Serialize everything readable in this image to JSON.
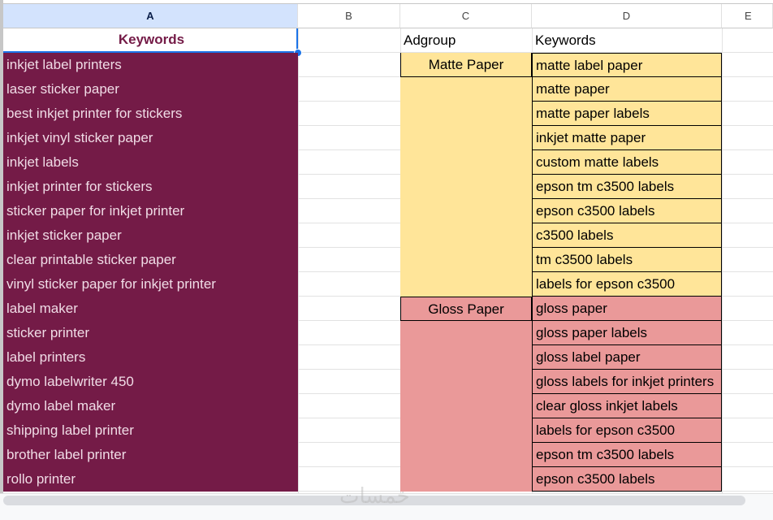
{
  "columns": [
    "A",
    "B",
    "C",
    "D",
    "E"
  ],
  "colA": {
    "header": "Keywords",
    "rows": [
      "inkjet label printers",
      "laser sticker paper",
      "best inkjet printer for stickers",
      "inkjet vinyl sticker paper",
      "inkjet labels",
      "inkjet printer for stickers",
      "sticker paper for inkjet printer",
      "inkjet sticker paper",
      "clear printable sticker paper",
      "vinyl sticker paper for inkjet printer",
      "label maker",
      "sticker printer",
      "label printers",
      "dymo labelwriter 450",
      "dymo label maker",
      "shipping label printer",
      "brother label printer",
      "rollo printer"
    ]
  },
  "colC": {
    "header": "Adgroup",
    "groups": [
      "Matte Paper",
      "Gloss Paper"
    ]
  },
  "colD": {
    "header": "Keywords",
    "rows": [
      "matte label paper",
      "matte paper",
      "matte paper labels",
      "inkjet matte paper",
      "custom matte labels",
      "epson tm c3500 labels",
      "epson c3500 labels",
      "c3500 labels",
      "tm c3500 labels",
      "labels for epson c3500",
      "gloss paper",
      "gloss paper labels",
      "gloss label paper",
      "gloss labels for inkjet printers",
      "clear gloss inkjet labels",
      "labels for epson c3500",
      "epson tm c3500 labels",
      "epson c3500 labels"
    ]
  },
  "colors": {
    "maroon": "#741b47",
    "matte": "#ffe599",
    "gloss": "#ea9999",
    "selection": "#1a73e8"
  },
  "watermark": "خمسات"
}
